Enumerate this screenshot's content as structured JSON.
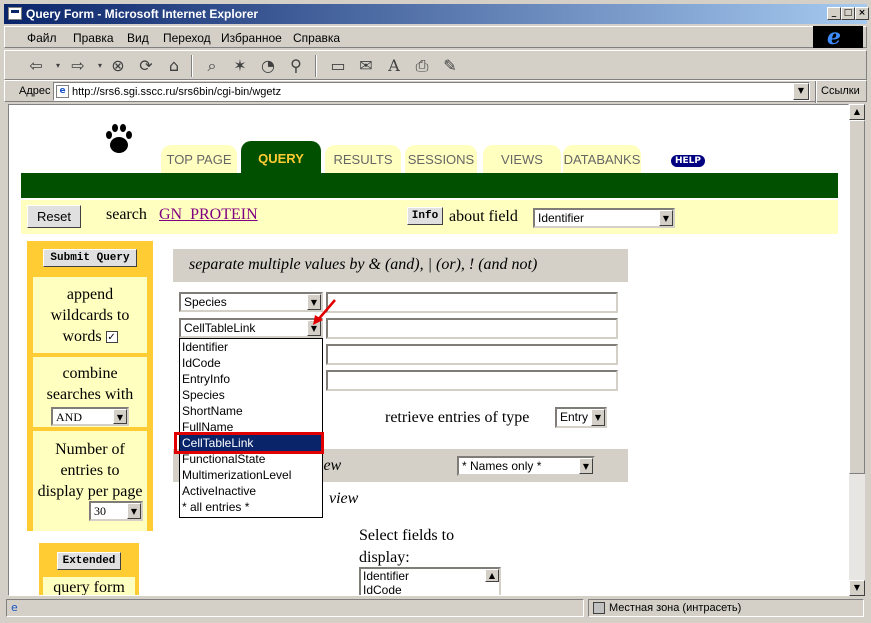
{
  "window": {
    "title": "Query Form - Microsoft Internet Explorer",
    "min": "_",
    "max": "□",
    "close": "×"
  },
  "menu": [
    "Файл",
    "Правка",
    "Вид",
    "Переход",
    "Избранное",
    "Справка"
  ],
  "address": {
    "label": "Адрес",
    "url": "http://srs6.sgi.sscc.ru/srs6bin/cgi-bin/wgetz",
    "links_label": "Ссылки"
  },
  "toolbar_icons": [
    "back-icon",
    "forward-icon",
    "stop-icon",
    "refresh-icon",
    "home-icon",
    "search-icon",
    "favorites-icon",
    "history-icon",
    "channels-icon",
    "fullscreen-icon",
    "mail-icon",
    "font-icon",
    "print-icon",
    "edit-icon"
  ],
  "tabs": [
    "TOP PAGE",
    "QUERY",
    "RESULTS",
    "SESSIONS",
    "VIEWS",
    "DATABANKS",
    "HELP"
  ],
  "search": {
    "reset": "Reset",
    "search_label": "search",
    "databank": "GN_PROTEIN",
    "info": "Info",
    "about_field": "about field",
    "field_value": "Identifier"
  },
  "left": {
    "submit": "Submit Query",
    "append_wildcards": "append wildcards to words",
    "append_checked": "✓",
    "combine": "combine searches with",
    "combine_value": "AND",
    "number_label": "Number of entries to display per page",
    "number_value": "30",
    "extended": "Extended",
    "query_form": "query form"
  },
  "main": {
    "hint": "separate multiple values by & (and), | (or), ! (and not)",
    "field1": "Species",
    "field2": "CellTableLink",
    "dropdown_items": [
      "Identifier",
      "IdCode",
      "EntryInfo",
      "Species",
      "ShortName",
      "FullName",
      "CellTableLink",
      "FunctionalState",
      "MultimerizationLevel",
      "ActiveInactive",
      "* all entries *"
    ],
    "dropdown_selected": "CellTableLink",
    "retrieve_label": "retrieve entries of type",
    "retrieve_value": "Entry",
    "view_label": "iew",
    "view_value": "* Names only *",
    "view2_label": "view",
    "select_fields": "Select fields to display:",
    "fields_list": [
      "Identifier",
      "IdCode"
    ]
  },
  "status": {
    "zone": "Местная зона (интрасеть)"
  },
  "colors": {
    "green": "#005000",
    "tab_bg": "#ffffc0",
    "yellow": "#ffcc33",
    "link": "#800080",
    "highlight": "#e00000"
  }
}
